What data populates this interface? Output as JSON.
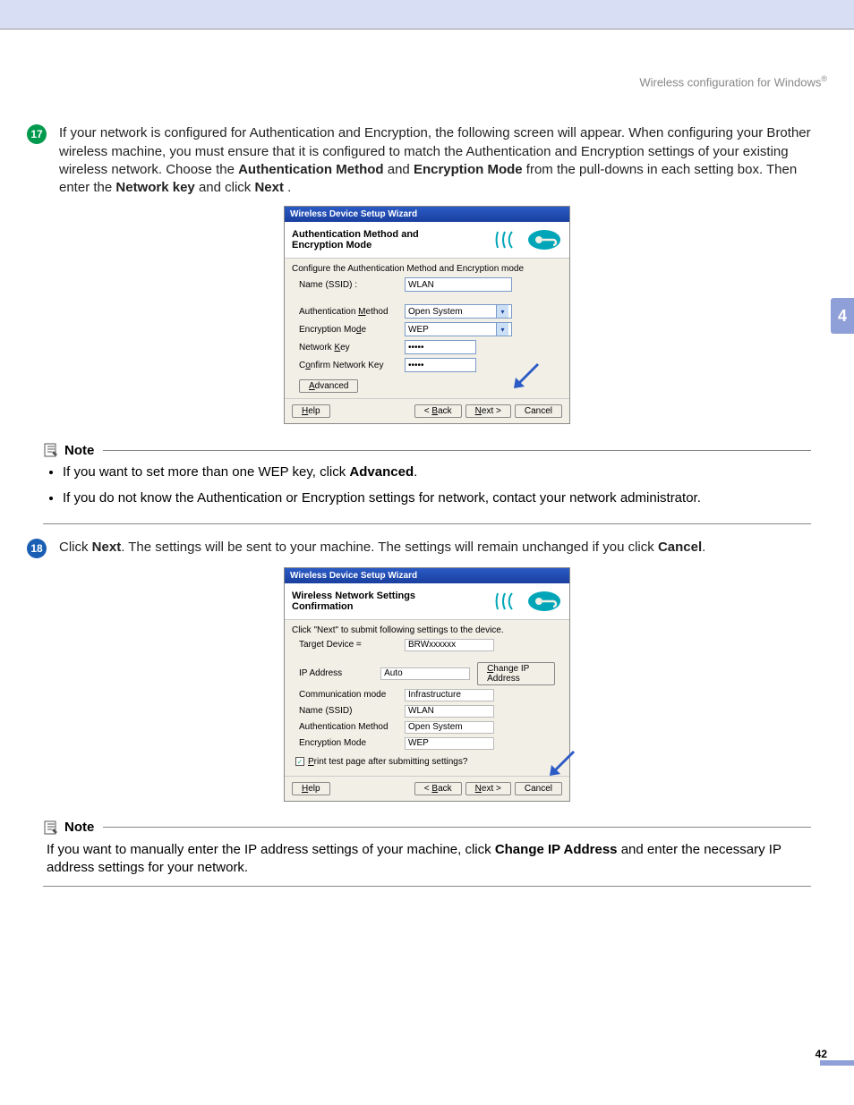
{
  "header": {
    "text": "Wireless configuration for Windows",
    "reg": "®"
  },
  "sidetab": "4",
  "pagenum": "42",
  "step17": {
    "num": "17",
    "body_a": "If your network is configured for Authentication and Encryption, the following screen will appear. When configuring your Brother wireless machine, you must ensure that it is configured to match the Authentication and Encryption settings of your existing wireless network. Choose the ",
    "bold_a": "Authentication Method",
    "mid_a": " and ",
    "bold_b": "Encryption Mode",
    "mid_b": " from the pull-downs in each setting box. Then enter the ",
    "bold_c": "Network key",
    "mid_c": " and click ",
    "bold_d": "Next",
    "end": "."
  },
  "dialog1": {
    "title": "Wireless Device Setup Wizard",
    "head": "Authentication Method and Encryption Mode",
    "sub": "Configure the Authentication Method and Encryption mode",
    "rows": {
      "ssid_l": "Name (SSID) :",
      "ssid_v": "WLAN",
      "auth_l": "Authentication Method",
      "auth_v": "Open System",
      "enc_l": "Encryption Mode",
      "enc_v": "WEP",
      "key_l": "Network Key",
      "key_v": "•••••",
      "ckey_l": "Confirm Network Key",
      "ckey_v": "•••••"
    },
    "advanced": "Advanced",
    "help": "Help",
    "back": "< Back",
    "next": "Next >",
    "cancel": "Cancel"
  },
  "note1": {
    "title": "Note",
    "li1a": "If you want to set more than one WEP key, click ",
    "li1b": "Advanced",
    "li1c": ".",
    "li2": "If you do not know the Authentication or Encryption settings for network, contact your network administrator."
  },
  "step18": {
    "num": "18",
    "a": "Click ",
    "b": "Next",
    "c": ". The settings will be sent to your machine. The settings will remain unchanged if you click ",
    "d": "Cancel",
    "e": "."
  },
  "dialog2": {
    "title": "Wireless Device Setup Wizard",
    "head": "Wireless Network Settings Confirmation",
    "sub": "Click \"Next\" to submit following settings to the device.",
    "rows": {
      "tgt_l": "Target Device =",
      "tgt_v": "BRWxxxxxx",
      "ip_l": "IP Address",
      "ip_v": "Auto",
      "comm_l": "Communication mode",
      "comm_v": "Infrastructure",
      "ssid_l": "Name (SSID)",
      "ssid_v": "WLAN",
      "auth_l": "Authentication Method",
      "auth_v": "Open System",
      "enc_l": "Encryption Mode",
      "enc_v": "WEP"
    },
    "change_ip": "Change IP Address",
    "print_cb": "Print test page after submitting settings?",
    "help": "Help",
    "back": "< Back",
    "next": "Next >",
    "cancel": "Cancel"
  },
  "note2": {
    "title": "Note",
    "a": "If you want to manually enter the IP address settings of your machine, click ",
    "b": "Change IP Address",
    "c": " and enter the necessary IP address settings for your network."
  }
}
